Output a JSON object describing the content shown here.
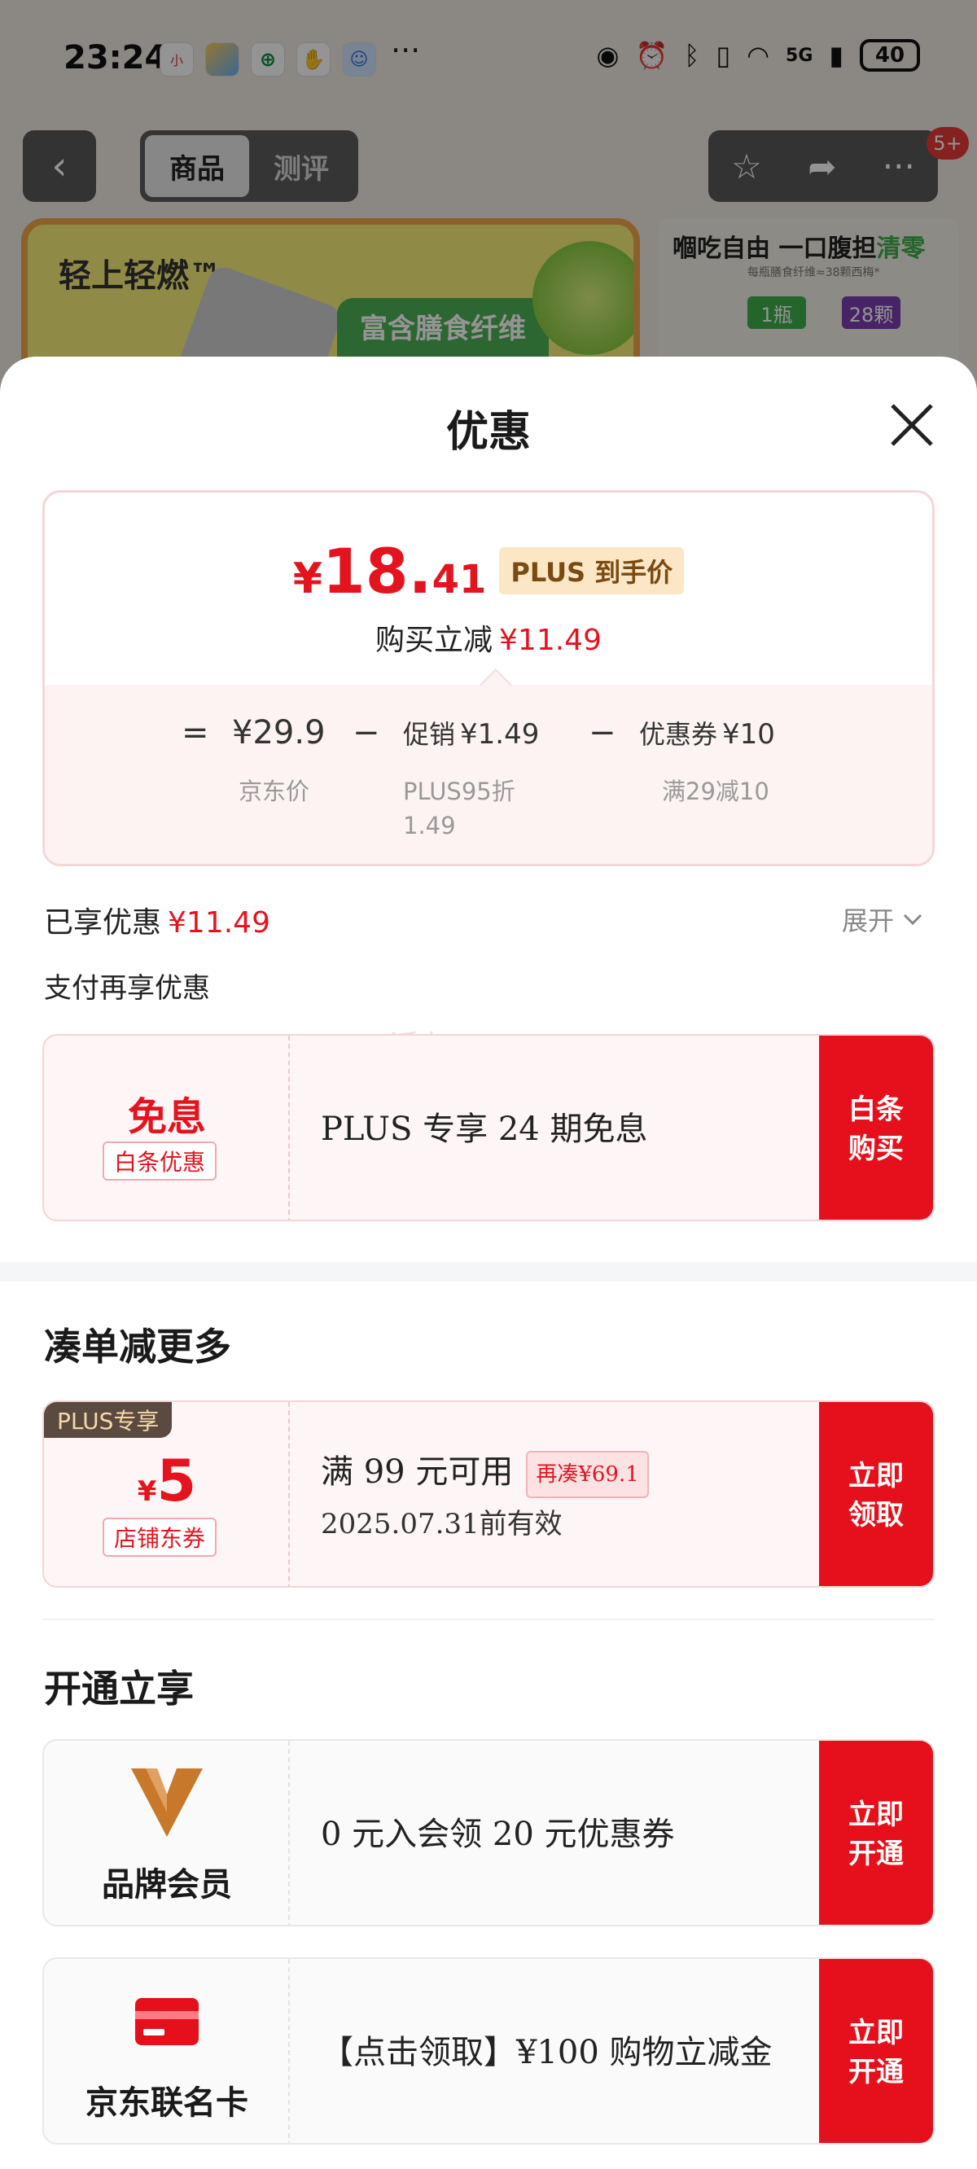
{
  "status_bar": {
    "time": "23:24",
    "app_icons": [
      "xiaohongshu-icon",
      "weather-icon",
      "china-post-icon",
      "hand-icon",
      "assistant-icon"
    ],
    "network": "5G",
    "battery": "40"
  },
  "background_page": {
    "tabs": [
      "商品",
      "测评"
    ],
    "active_tab": "商品",
    "badge": "5+",
    "banner_left": {
      "slogan": "轻上轻燃™",
      "tag": "富含膳食纤维"
    },
    "banner_right": {
      "headline": "嗰吃自由 一口腹担",
      "headline_highlight": "清零",
      "sub": "每瓶膳食纤维≈38颗西梅*",
      "chip1": "1瓶",
      "chip2": "28颗"
    }
  },
  "sheet": {
    "title": "优惠",
    "price_card": {
      "currency": "¥",
      "price_int": "18.",
      "price_dec": "41",
      "plus_tag": "PLUS 到手价",
      "reduce_label": "购买立减",
      "reduce_value": "¥11.49",
      "breakdown": {
        "eq": "=",
        "jd_price": "¥29.9",
        "jd_price_label": "京东价",
        "minus1": "−",
        "promo_label": "促销",
        "promo_value": "¥1.49",
        "promo_sub1": "PLUS95折",
        "promo_sub2": "1.49",
        "minus2": "−",
        "coupon_label": "优惠券",
        "coupon_value": "¥10",
        "coupon_sub": "满29减10"
      }
    },
    "enjoyed_label": "已享优惠",
    "enjoyed_value": "¥11.49",
    "expand_label": "展开",
    "pay_title": "支付再享优惠",
    "watermark": "浮夸0700",
    "baitiao_card": {
      "left_title": "免息",
      "left_tag": "白条优惠",
      "main": "PLUS 专享 24 期免息",
      "button": "白条购买"
    },
    "section_combine": "凑单减更多",
    "store_coupon": {
      "plus_corner": "PLUS专享",
      "currency": "¥",
      "amount": "5",
      "tag": "店铺东券",
      "main": "满 99 元可用",
      "extra": "再凑¥69.1",
      "sub": "2025.07.31前有效",
      "button": "立即领取"
    },
    "section_open": "开通立享",
    "brand_member": {
      "label": "品牌会员",
      "main": "0 元入会领 20 元优惠券",
      "button": "立即开通",
      "logo_color": "#c8782a"
    },
    "jd_card": {
      "label": "京东联名卡",
      "main": "【点击领取】¥100 购物立减金",
      "button": "立即开通"
    }
  },
  "colors": {
    "accent_red": "#e4141f",
    "button_red": "#e5101b",
    "plus_gold_bg": "#fbe7c6"
  }
}
